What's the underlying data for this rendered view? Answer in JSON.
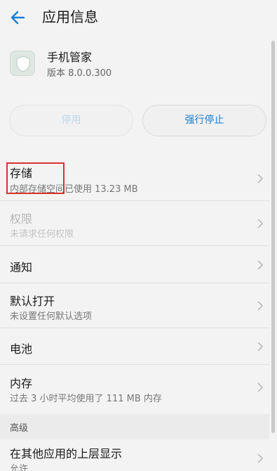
{
  "header": {
    "title": "应用信息",
    "back_icon": "arrow-left-icon",
    "accent": "#1a7ed6"
  },
  "app": {
    "name": "手机管家",
    "version": "版本 8.0.0.300",
    "icon": "shield-icon"
  },
  "actions": {
    "disable_label": "停用",
    "force_stop_label": "强行停止"
  },
  "rows": [
    {
      "title": "存储",
      "subtitle": "内部存储空间已使用 13.23 MB"
    },
    {
      "title": "权限",
      "subtitle": "未请求任何权限"
    },
    {
      "title": "通知"
    },
    {
      "title": "默认打开",
      "subtitle": "未设置任何默认选项"
    },
    {
      "title": "电池"
    },
    {
      "title": "内存",
      "subtitle": "过去 3 小时平均使用了 111 MB 内存"
    }
  ],
  "advanced": {
    "section_label": "高级",
    "rows": [
      {
        "title": "在其他应用的上层显示",
        "subtitle": "允许"
      }
    ]
  }
}
